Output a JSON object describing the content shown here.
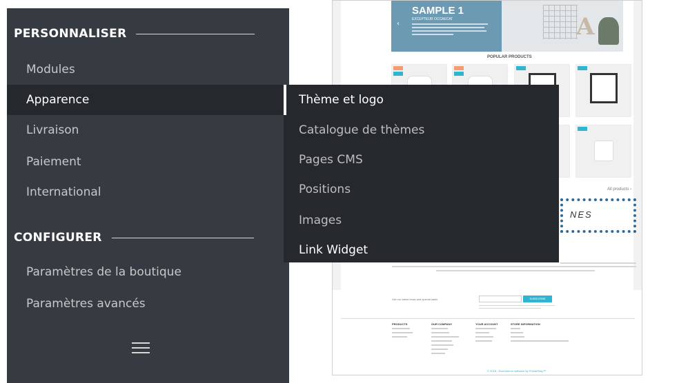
{
  "sidebar": {
    "sections": [
      {
        "title": "PERSONNALISER",
        "items": [
          {
            "label": "Modules"
          },
          {
            "label": "Apparence"
          },
          {
            "label": "Livraison"
          },
          {
            "label": "Paiement"
          },
          {
            "label": "International"
          }
        ]
      },
      {
        "title": "CONFIGURER",
        "items": [
          {
            "label": "Paramètres de la boutique"
          },
          {
            "label": "Paramètres avancés"
          }
        ]
      }
    ],
    "active_item": "Apparence"
  },
  "submenu": {
    "items": [
      {
        "label": "Thème et logo"
      },
      {
        "label": "Catalogue de thèmes"
      },
      {
        "label": "Pages CMS"
      },
      {
        "label": "Positions"
      },
      {
        "label": "Images"
      },
      {
        "label": "Link Widget"
      }
    ]
  },
  "preview": {
    "banner_title": "SAMPLE 1",
    "banner_subtitle": "EXCEPTEUR OCCAECAT",
    "popular_heading": "POPULAR PRODUCTS",
    "all_products": "All products ›",
    "pattern_text": "NES",
    "subscribe_label": "SUBSCRIBE",
    "footer_columns": [
      "PRODUCTS",
      "OUR COMPANY",
      "YOUR ACCOUNT",
      "STORE INFORMATION"
    ]
  },
  "colors": {
    "sidebar_bg": "#363a41",
    "active_bg": "#25282d",
    "accent": "#2fb5d2"
  }
}
